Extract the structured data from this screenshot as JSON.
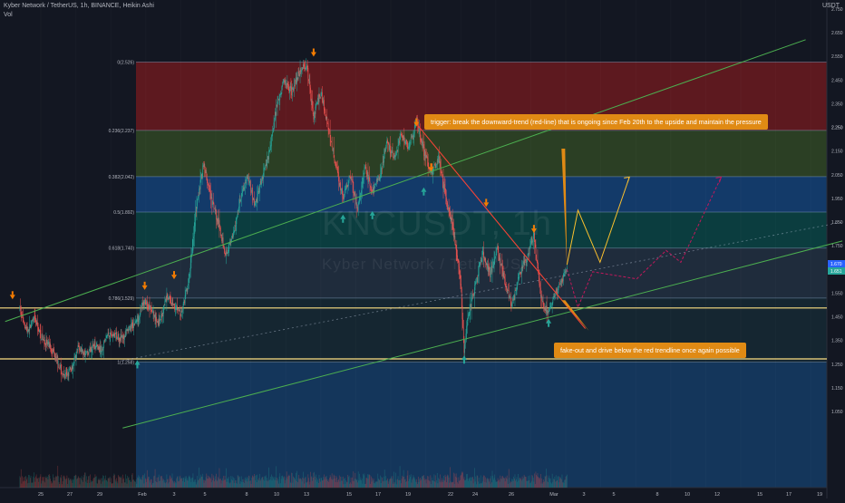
{
  "header": {
    "title": "Kyber Network / TetherUS, 1h, BINANCE, Heikin Ashi",
    "volume_label": "Vol",
    "unit": "USDT"
  },
  "watermark": {
    "symbol": "KNCUSDT, 1h",
    "name": "Kyber Network / TetherUS"
  },
  "annotations": {
    "trigger": "trigger: break the downward-trend (red-line) that is ongoing since Feb 20th to the upside and maintain the pressure",
    "fakeout": "fake-out and drive below the red trendline once again possible"
  },
  "colors": {
    "background": "#131722",
    "bull_candle": "#26a69a",
    "bear_candle": "#ef5350",
    "arrow_down": "#f57c00",
    "arrow_up": "#26a69a",
    "channel": "#4caf50",
    "downtrend": "#f44336",
    "support": "#ffe082",
    "bull_path": "#fbc02d",
    "alt_path": "#c2185b",
    "note_bg": "#e08a14"
  },
  "chart_data": {
    "type": "candlestick",
    "price_scale": {
      "ticks": [
        "2.650",
        "2.550",
        "2.450",
        "2.350",
        "2.250",
        "2.150",
        "2.050",
        "1.950",
        "1.850",
        "1.750",
        "1.650",
        "1.550",
        "1.450",
        "1.350",
        "1.250",
        "1.150",
        "1.050"
      ],
      "tick_values": [
        2.65,
        2.55,
        2.45,
        2.35,
        2.25,
        2.15,
        2.05,
        1.95,
        1.85,
        1.75,
        1.65,
        1.55,
        1.45,
        1.35,
        1.25,
        1.15,
        1.05
      ],
      "extra_ticks": [
        [
          "2.750",
          2.75
        ],
        [
          "2.250",
          2.25
        ]
      ],
      "current_price": "1.651",
      "current_label": "1.670"
    },
    "time_labels": [
      "25",
      "27",
      "29",
      "Feb",
      "3",
      "5",
      "8",
      "10",
      "13",
      "15",
      "17",
      "19",
      "22",
      "24",
      "26",
      "Mar",
      "3",
      "5",
      "8",
      "10",
      "12",
      "15",
      "17",
      "19"
    ],
    "fibonacci": [
      {
        "level": "0(2.526)",
        "price": 2.526
      },
      {
        "level": "0.236(2.237)",
        "price": 2.237
      },
      {
        "level": "0.382(2.042)",
        "price": 2.042
      },
      {
        "level": "0.5(1.892)",
        "price": 1.892
      },
      {
        "level": "0.618(1.740)",
        "price": 1.74
      },
      {
        "level": "0.786(1.529)",
        "price": 1.529
      },
      {
        "level": "1(1.258)",
        "price": 1.258
      }
    ],
    "support_lines": [
      1.487,
      1.272
    ],
    "ohlc_path": [
      [
        "01-24 00",
        1.48
      ],
      [
        "01-24 12",
        1.39
      ],
      [
        "01-25 00",
        1.44
      ],
      [
        "01-25 12",
        1.36
      ],
      [
        "01-26 00",
        1.33
      ],
      [
        "01-26 12",
        1.28
      ],
      [
        "01-27 00",
        1.19
      ],
      [
        "01-27 12",
        1.23
      ],
      [
        "01-28 00",
        1.32
      ],
      [
        "01-28 12",
        1.29
      ],
      [
        "01-29 00",
        1.33
      ],
      [
        "01-29 12",
        1.31
      ],
      [
        "01-30 00",
        1.38
      ],
      [
        "01-31 00",
        1.36
      ],
      [
        "02-01 00",
        1.44
      ],
      [
        "02-01 12",
        1.52
      ],
      [
        "02-02 00",
        1.47
      ],
      [
        "02-02 12",
        1.42
      ],
      [
        "02-03 00",
        1.54
      ],
      [
        "02-03 12",
        1.5
      ],
      [
        "02-04 00",
        1.46
      ],
      [
        "02-04 12",
        1.6
      ],
      [
        "02-05 00",
        1.9
      ],
      [
        "02-05 12",
        2.1
      ],
      [
        "02-06 00",
        1.95
      ],
      [
        "02-06 12",
        1.85
      ],
      [
        "02-07 00",
        1.72
      ],
      [
        "02-07 12",
        1.78
      ],
      [
        "02-08 00",
        1.95
      ],
      [
        "02-08 12",
        2.05
      ],
      [
        "02-09 00",
        1.92
      ],
      [
        "02-10 00",
        2.15
      ],
      [
        "02-10 12",
        2.35
      ],
      [
        "02-11 00",
        2.45
      ],
      [
        "02-11 12",
        2.4
      ],
      [
        "02-12 00",
        2.48
      ],
      [
        "02-12 12",
        2.52
      ],
      [
        "02-13 00",
        2.3
      ],
      [
        "02-13 12",
        2.4
      ],
      [
        "02-14 00",
        2.25
      ],
      [
        "02-14 12",
        2.1
      ],
      [
        "02-15 00",
        1.95
      ],
      [
        "02-15 12",
        2.05
      ],
      [
        "02-16 00",
        1.9
      ],
      [
        "02-16 12",
        2.08
      ],
      [
        "02-17 00",
        1.97
      ],
      [
        "02-17 12",
        2.05
      ],
      [
        "02-18 00",
        2.18
      ],
      [
        "02-18 12",
        2.12
      ],
      [
        "02-19 00",
        2.22
      ],
      [
        "02-19 12",
        2.16
      ],
      [
        "02-20 00",
        2.28
      ],
      [
        "02-20 12",
        2.15
      ],
      [
        "02-21 00",
        2.06
      ],
      [
        "02-21 12",
        2.12
      ],
      [
        "02-22 00",
        1.95
      ],
      [
        "02-22 12",
        1.82
      ],
      [
        "02-23 00",
        1.6
      ],
      [
        "02-23 06",
        1.3
      ],
      [
        "02-23 12",
        1.45
      ],
      [
        "02-24 00",
        1.58
      ],
      [
        "02-24 12",
        1.72
      ],
      [
        "02-25 00",
        1.63
      ],
      [
        "02-25 12",
        1.74
      ],
      [
        "02-26 00",
        1.6
      ],
      [
        "02-26 12",
        1.5
      ],
      [
        "02-27 00",
        1.62
      ],
      [
        "02-27 12",
        1.7
      ],
      [
        "02-28 00",
        1.8
      ],
      [
        "02-28 06",
        1.66
      ],
      [
        "02-28 12",
        1.52
      ],
      [
        "03-01 00",
        1.46
      ],
      [
        "03-01 12",
        1.55
      ],
      [
        "03-02 00",
        1.61
      ],
      [
        "03-02 06",
        1.65
      ]
    ],
    "arrows_down": [
      [
        "01-23 12",
        1.535
      ],
      [
        "02-01 12",
        1.575
      ],
      [
        "02-03 12",
        1.62
      ],
      [
        "02-13 00",
        2.56
      ],
      [
        "02-20 00",
        2.265
      ],
      [
        "02-21 00",
        2.075
      ],
      [
        "02-24 18",
        1.925
      ],
      [
        "02-28 00",
        1.815
      ]
    ],
    "arrows_up": [
      [
        "02-01 00",
        1.255
      ],
      [
        "02-15 00",
        1.87
      ],
      [
        "02-17 00",
        1.885
      ],
      [
        "02-20 12",
        1.985
      ],
      [
        "02-23 06",
        1.275
      ],
      [
        "03-01 00",
        1.43
      ]
    ],
    "channel_lines": [
      {
        "from": [
          "01-23 00",
          1.43
        ],
        "to": [
          "03-18 12",
          2.62
        ]
      },
      {
        "from": [
          "01-31 00",
          0.98
        ],
        "to": [
          "03-21 00",
          1.77
        ]
      }
    ],
    "channel_mid": {
      "from": [
        "01-31 00",
        1.265
      ],
      "to": [
        "03-21 00",
        1.85
      ]
    },
    "downtrend_line": {
      "from": [
        "02-20 00",
        2.265
      ],
      "to": [
        "03-03 12",
        1.4
      ]
    },
    "projection_bull": [
      [
        "03-02 06",
        1.67
      ],
      [
        "03-03 00",
        1.9
      ],
      [
        "03-04 12",
        1.68
      ],
      [
        "03-06 12",
        2.04
      ]
    ],
    "projection_alt": [
      [
        "03-02 06",
        1.65
      ],
      [
        "03-03 00",
        1.49
      ],
      [
        "03-04 00",
        1.64
      ],
      [
        "03-07 00",
        1.61
      ],
      [
        "03-09 00",
        1.73
      ],
      [
        "03-10 00",
        1.68
      ],
      [
        "03-12 18",
        2.04
      ]
    ],
    "annotation_pointers": [
      {
        "from": [
          "03-02 00",
          2.16
        ],
        "to": [
          "03-02 06",
          1.66
        ]
      },
      {
        "from": [
          "03-02 00",
          1.52
        ],
        "to": [
          "03-03 18",
          1.39
        ]
      }
    ]
  }
}
